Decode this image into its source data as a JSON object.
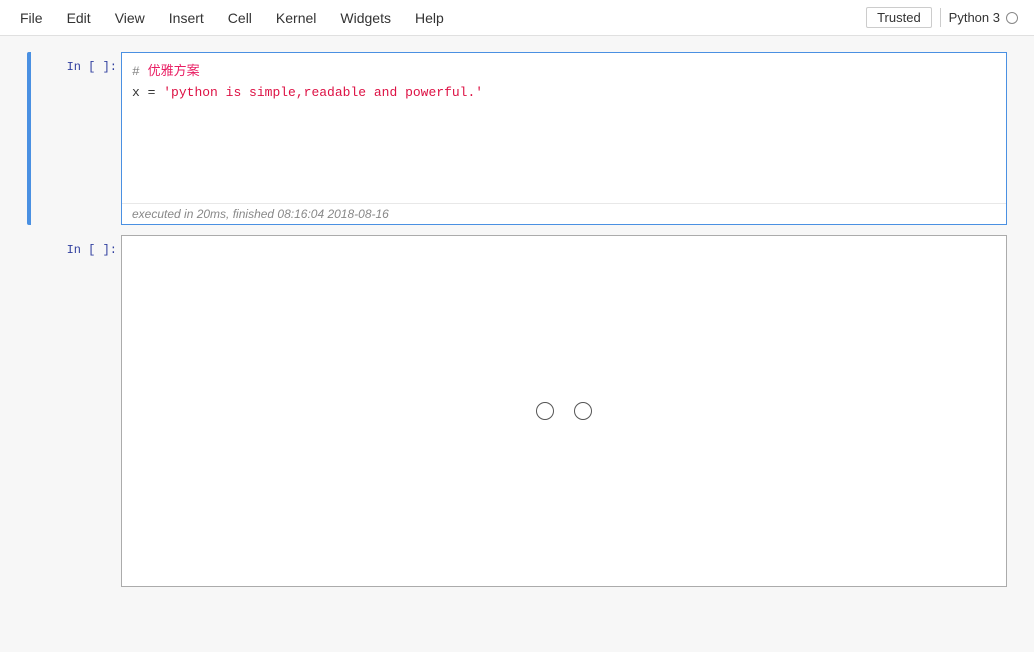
{
  "menubar": {
    "items": [
      {
        "label": "File",
        "id": "file"
      },
      {
        "label": "Edit",
        "id": "edit"
      },
      {
        "label": "View",
        "id": "view"
      },
      {
        "label": "Insert",
        "id": "insert"
      },
      {
        "label": "Cell",
        "id": "cell"
      },
      {
        "label": "Kernel",
        "id": "kernel"
      },
      {
        "label": "Widgets",
        "id": "widgets"
      },
      {
        "label": "Help",
        "id": "help"
      }
    ],
    "trusted_label": "Trusted",
    "kernel_label": "Python 3"
  },
  "cells": [
    {
      "id": "cell1",
      "prompt": "In  [  ]:",
      "selected": true,
      "code_line1_comment": "# 优雅方案",
      "code_line2": "x = 'python is simple,readable and powerful.'",
      "execution_note": "executed in 20ms, finished 08:16:04 2018-08-16"
    },
    {
      "id": "cell2",
      "prompt": "In  [  ]:",
      "selected": false,
      "empty": true
    }
  ],
  "dots": {
    "count": 2
  }
}
